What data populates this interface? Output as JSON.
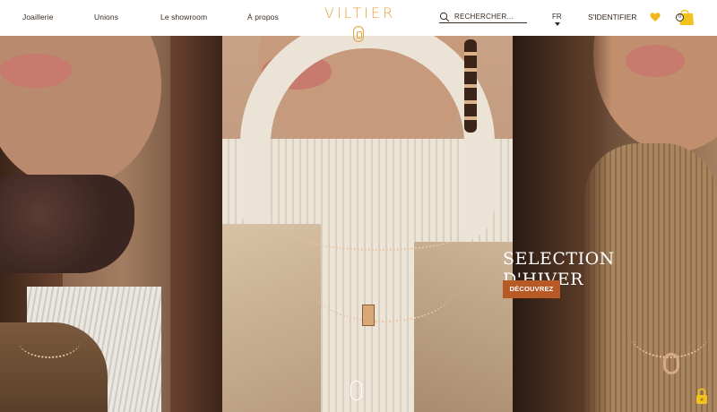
{
  "header": {
    "nav": [
      "Joaillerie",
      "Unions",
      "Le showroom",
      "À propos"
    ],
    "logo": "VILTIER",
    "search_placeholder": "RECHERCHER...",
    "language": "FR",
    "login_label": "S'IDENTIFIER",
    "cart_count": "0"
  },
  "hero": {
    "title_line1": "SELECTION",
    "title_line2": "D'HIVER",
    "cta_label": "DÉCOUVREZ"
  },
  "icons": {
    "search": "search-icon",
    "favorites": "heart-icon",
    "cart": "shopping-bag-icon",
    "scroll": "scroll-mouse-icon",
    "padlock": "padlock-icon"
  },
  "colors": {
    "brand": "#e3a23a",
    "cta": "#b85a26",
    "text": "#3a2a20",
    "heart": "#f2b51c",
    "bag": "#f4c21d"
  }
}
